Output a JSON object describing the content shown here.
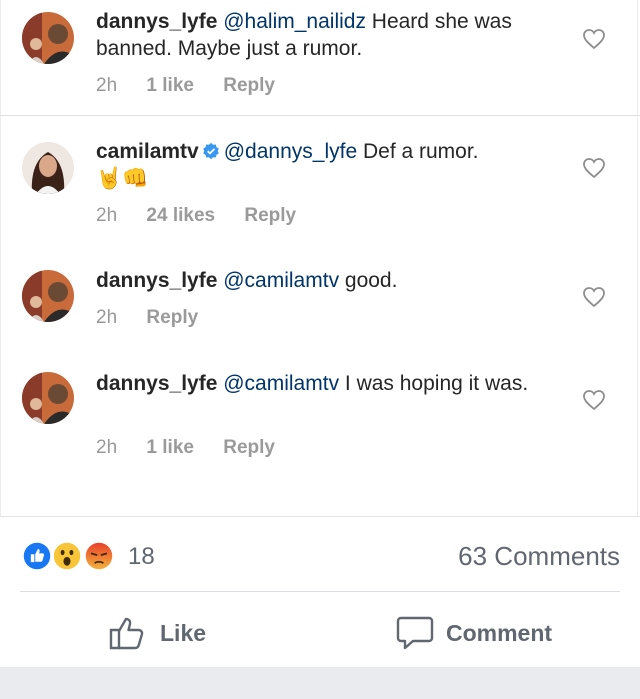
{
  "comments": [
    {
      "username": "dannys_lyfe",
      "mention": "@halim_nailidz",
      "text": " Heard she was banned. Maybe just a rumor.",
      "time": "2h",
      "likes": "1 like",
      "reply": "Reply",
      "verified": false
    },
    {
      "username": "camilamtv",
      "mention": "@dannys_lyfe",
      "text": " Def a rumor.",
      "emojis": "🤘👊",
      "time": "2h",
      "likes": "24 likes",
      "reply": "Reply",
      "verified": true
    },
    {
      "username": "dannys_lyfe",
      "mention": "@camilamtv",
      "text": " good.",
      "time": "2h",
      "reply": "Reply",
      "verified": false
    },
    {
      "username": "dannys_lyfe",
      "mention": "@camilamtv",
      "text": " I was hoping it was.",
      "time": "2h",
      "likes": "1 like",
      "reply": "Reply",
      "verified": false
    }
  ],
  "facebook_bar": {
    "reaction_count": "18",
    "comments_count": "63 Comments",
    "like_label": "Like",
    "comment_label": "Comment"
  },
  "colors": {
    "mention": "#003569",
    "meta": "#999999",
    "fb_gray": "#606770",
    "like_blue": "#1877f2"
  },
  "icons": [
    "heart-icon",
    "verified-icon",
    "like-reaction-icon",
    "wow-reaction-icon",
    "angry-reaction-icon",
    "thumbs-up-icon",
    "speech-bubble-icon"
  ]
}
